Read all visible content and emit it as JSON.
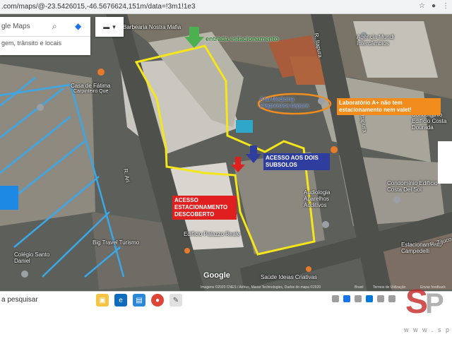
{
  "browser": {
    "url": ".com/maps/@-23.5426015,-46.5676624,151m/data=!3m1!1e3"
  },
  "maps_panel": {
    "search_title": "gle Maps",
    "search_sub": "gem, trânsito e locais"
  },
  "map_labels": [
    "Barbearia Nostra Mafia",
    "Agência Mundi Intercâmbios",
    "Casa de Fátima",
    "Carpinteiro Que",
    "Ana Medicina Diagnóstica Itapura",
    "Condomínio Edifício Costa Dourada",
    "Condomínio Edifício Costa Del Sol",
    "Audiologia Aparelhos Auditivos",
    "Edifício Palazzo Reale",
    "Big Travel Turismo",
    "Colégio Santo Daniel",
    "Estacionamento Campedelli",
    "Saúde Ideias Criativas",
    "R. Itapura",
    "R. Tijuco",
    "R. Ari"
  ],
  "annotations": {
    "entrance": "entrada estacionamento",
    "two_basements": "ACESSO AOS DOIS SUBSOLOS",
    "open_parking": "ACESSO ESTACIONAMENTO DESCOBERTO",
    "lab_note": "Laboratório A+ não tem estacionamento nem valet!"
  },
  "footer": {
    "google": "Google",
    "attribution": "Imagens ©2020 CNES / Airbus, Maxar Technologies, Dados do mapa ©2020",
    "country": "Brasil",
    "terms": "Termos de Utilização",
    "report": "Enviar feedback"
  },
  "taskbar": {
    "search_placeholder": "a pesquisar"
  },
  "watermark": {
    "site": "w w w . s p i m ."
  },
  "colors": {
    "outline": "#f5e51b",
    "blue_lines": "#3aa8e8",
    "green_arrow": "#4caf50",
    "blue_arrow": "#2f3d9e",
    "red_arrow": "#e0201f",
    "orange_ellipse": "#f28c1c"
  }
}
